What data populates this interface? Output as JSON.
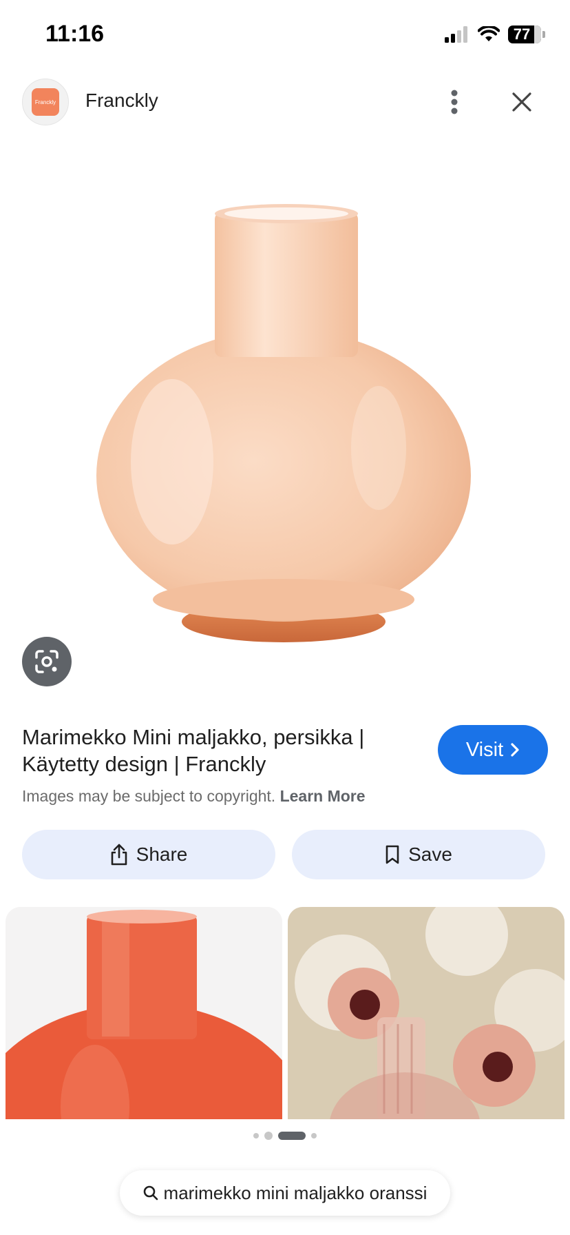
{
  "status_bar": {
    "time": "11:16",
    "battery": "77"
  },
  "header": {
    "source_name": "Franckly",
    "avatar_text": "Franckly"
  },
  "image": {
    "title": "Marimekko Mini maljakko, persikka | Käytetty design | Franckly",
    "copyright_text": "Images may be subject to copyright.",
    "learn_more": "Learn More",
    "visit_label": "Visit"
  },
  "actions": {
    "share_label": "Share",
    "save_label": "Save"
  },
  "search": {
    "query": "marimekko mini maljakko oranssi"
  },
  "colors": {
    "accent": "#1a73e8",
    "action_bg": "#e8eefc",
    "vase_peach": "#f7cdb0",
    "vase_orange": "#ea5b3a"
  },
  "icons": [
    "signal-icon",
    "wifi-icon",
    "battery-icon",
    "more-vert-icon",
    "close-icon",
    "lens-icon",
    "chevron-right-icon",
    "share-icon",
    "bookmark-icon",
    "search-icon"
  ]
}
